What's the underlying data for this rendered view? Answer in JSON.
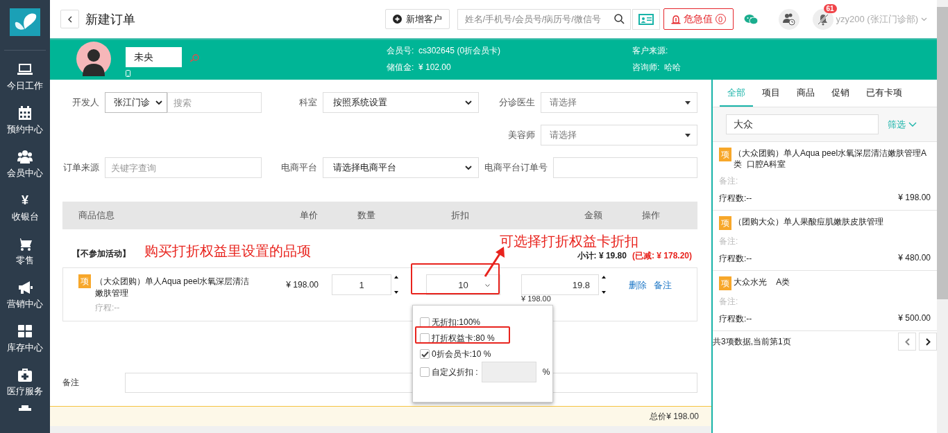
{
  "sidebar": {
    "items": [
      {
        "kind": "laptop",
        "label": "今日工作",
        "selected": false
      },
      {
        "kind": "calendar",
        "label": "预约中心",
        "selected": false
      },
      {
        "kind": "users",
        "label": "会员中心",
        "selected": false
      },
      {
        "kind": "glyph",
        "glyph": "¥",
        "label": "收银台",
        "selected": false
      },
      {
        "kind": "cart",
        "label": "零售",
        "selected": false
      },
      {
        "kind": "megaphone",
        "label": "营销中心",
        "selected": false
      },
      {
        "kind": "grid",
        "label": "库存中心",
        "selected": false
      },
      {
        "kind": "medkit",
        "label": "医疗服务",
        "selected": false
      }
    ]
  },
  "header": {
    "title": "新建订单",
    "add_customer": "新增客户",
    "search_placeholder": "姓名/手机号/会员号/病历号/微信号",
    "alert_label": "危急值",
    "alert_count": "0",
    "notifications": "61",
    "user": "yzy200 (张江门诊部)"
  },
  "customer": {
    "name": "未央",
    "info": [
      {
        "label": "会员号:",
        "value": "cs302645 (0折会员卡)"
      },
      {
        "label": "储值金:",
        "value": "¥ 102.00"
      },
      {
        "label": "客户来源:"
      },
      {
        "label": "咨询师:",
        "value": "哈哈"
      }
    ]
  },
  "form": {
    "rows": [
      {
        "fields": [
          {
            "label": "开发人",
            "kind": "select_search",
            "value": "张江门诊",
            "placeholder": "搜索"
          },
          {
            "label": "科室",
            "kind": "select",
            "value": "按照系统设置"
          },
          {
            "label": "分诊医生",
            "kind": "dropdown",
            "placeholder": "请选择"
          }
        ]
      },
      {
        "fields": [
          {
            "label": "美容师",
            "kind": "dropdown",
            "placeholder": "请选择"
          }
        ]
      },
      {
        "fields": [
          {
            "label": "订单来源",
            "kind": "input",
            "placeholder": "关键字查询"
          },
          {
            "label": "电商平台",
            "kind": "select",
            "value": "请选择电商平台"
          },
          {
            "label": "电商平台订单号",
            "kind": "input"
          }
        ]
      }
    ]
  },
  "table": {
    "columns": [
      "商品信息",
      "单价",
      "数量",
      "折扣",
      "金额",
      "操作"
    ],
    "group": {
      "label": "【不参加活动】",
      "subtotal": "小计: ¥ 19.80",
      "saved": "(已减: ¥ 178.20)"
    },
    "rows": [
      {
        "badge": "项",
        "name": "（大众团购）单人Aqua peel水氧深层清洁嫩肤管理",
        "course": "疗程:--",
        "price": "¥ 198.00",
        "quantity": "1",
        "discount": "10",
        "amount": "19.8",
        "original": "¥ 198.00",
        "actions": [
          "删除",
          "备注"
        ]
      }
    ]
  },
  "discount_popup": {
    "options": [
      {
        "label": "无折扣:100%",
        "checked": false
      },
      {
        "label": "打折权益卡:80 %",
        "checked": false
      },
      {
        "label": "0折会员卡:10 %",
        "checked": true
      }
    ],
    "custom": {
      "label": "自定义折扣 :",
      "unit": "%",
      "checked": false
    }
  },
  "remark": {
    "label": "备注"
  },
  "total": "总价¥ 198.00",
  "annotations": [
    {
      "text": "购买打折权益里设置的品项"
    },
    {
      "text": "可选择打折权益卡折扣"
    }
  ],
  "side_panel": {
    "tabs": [
      {
        "label": "全部",
        "selected": true
      },
      {
        "label": "项目",
        "selected": false
      },
      {
        "label": "商品",
        "selected": false
      },
      {
        "label": "促销",
        "selected": false
      },
      {
        "label": "已有卡项",
        "selected": false
      }
    ],
    "search_value": "大众",
    "filter": "筛选",
    "items": [
      {
        "badge": "项",
        "name": "（大众团购）单人Aqua peel水氧深层清洁嫩肤管理A类  口腔A科室",
        "remark": "备注:",
        "course": "疗程数:--",
        "price": "¥ 198.00"
      },
      {
        "badge": "项",
        "name": "（团购大众）单人果酸痘肌嫩肤皮肤管理",
        "remark": "备注:",
        "course": "疗程数:--",
        "price": "¥ 480.00"
      },
      {
        "badge": "项",
        "name": "大众水光    A类",
        "remark": "备注:",
        "course": "疗程数:--",
        "price": "¥ 500.00"
      }
    ],
    "pagination": "共3项数据,当前第1页"
  }
}
